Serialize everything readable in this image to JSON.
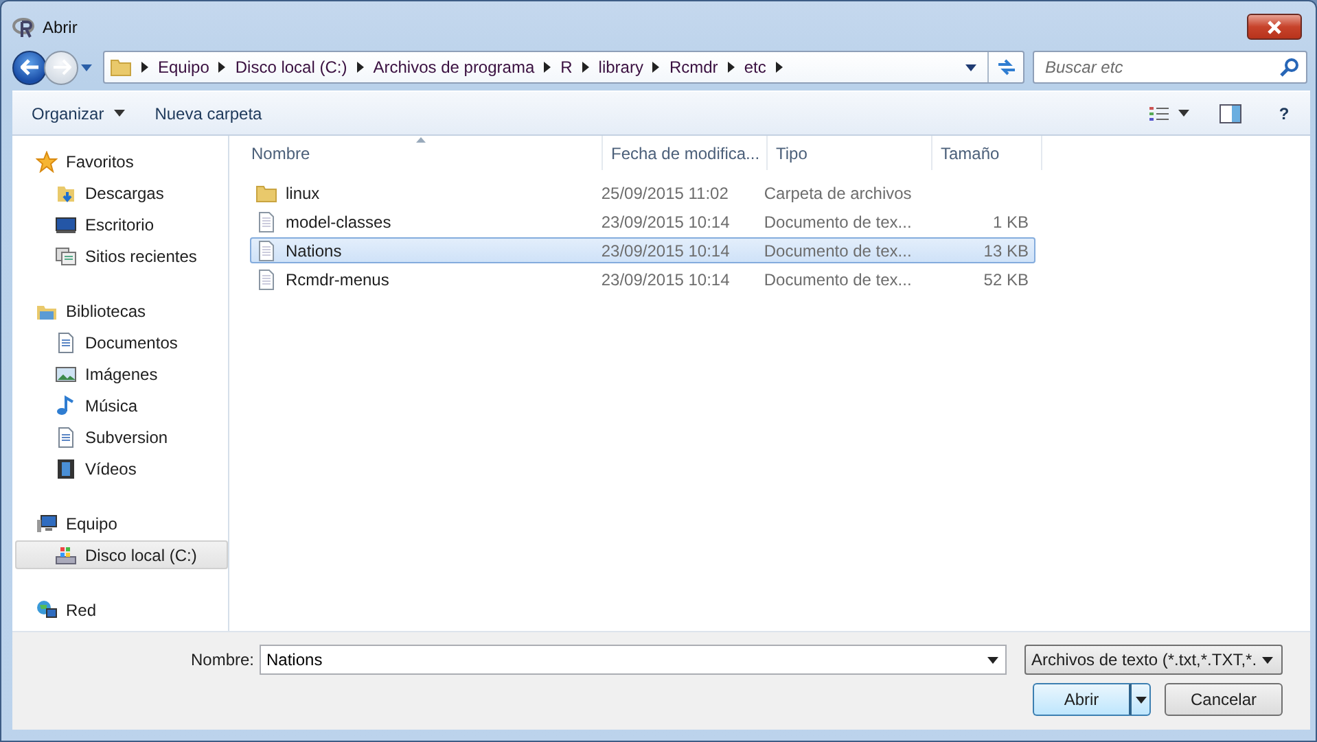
{
  "window": {
    "title": "Abrir"
  },
  "address_bar": {
    "crumbs": [
      "Equipo",
      "Disco local (C:)",
      "Archivos de programa",
      "R",
      "library",
      "Rcmdr",
      "etc"
    ]
  },
  "search": {
    "placeholder": "Buscar etc"
  },
  "toolbar": {
    "organize": "Organizar",
    "new_folder": "Nueva carpeta",
    "help": "?"
  },
  "sidebar": {
    "groups": [
      {
        "label": "Favoritos",
        "kind": "star",
        "selected": false,
        "children": [
          {
            "label": "Descargas",
            "kind": "downloads",
            "selected": false
          },
          {
            "label": "Escritorio",
            "kind": "desktop",
            "selected": false
          },
          {
            "label": "Sitios recientes",
            "kind": "recent",
            "selected": false
          }
        ]
      },
      {
        "label": "Bibliotecas",
        "kind": "library",
        "selected": false,
        "children": [
          {
            "label": "Documentos",
            "kind": "document",
            "selected": false
          },
          {
            "label": "Imágenes",
            "kind": "pictures",
            "selected": false
          },
          {
            "label": "Música",
            "kind": "music",
            "selected": false
          },
          {
            "label": "Subversion",
            "kind": "document",
            "selected": false
          },
          {
            "label": "Vídeos",
            "kind": "video",
            "selected": false
          }
        ]
      },
      {
        "label": "Equipo",
        "kind": "computer",
        "selected": false,
        "children": [
          {
            "label": "Disco local (C:)",
            "kind": "drive",
            "selected": true
          }
        ]
      },
      {
        "label": "Red",
        "kind": "network",
        "selected": false
      }
    ]
  },
  "table": {
    "columns": [
      "Nombre",
      "Fecha de modifica...",
      "Tipo",
      "Tamaño"
    ],
    "rows": [
      {
        "kind": "folder",
        "name": "linux",
        "date": "25/09/2015 11:02",
        "type": "Carpeta de archivos",
        "selected": false
      },
      {
        "kind": "text",
        "name": "model-classes",
        "date": "23/09/2015 10:14",
        "type": "Documento de tex...",
        "size": "1 KB",
        "selected": false
      },
      {
        "kind": "text",
        "name": "Nations",
        "date": "23/09/2015 10:14",
        "type": "Documento de tex...",
        "size": "13 KB",
        "selected": true
      },
      {
        "kind": "text",
        "name": "Rcmdr-menus",
        "date": "23/09/2015 10:14",
        "type": "Documento de tex...",
        "size": "52 KB",
        "selected": false
      }
    ]
  },
  "footer": {
    "filename_label": "Nombre:",
    "filename": "Nations",
    "filter": "Archivos de texto (*.txt,*.TXT,*.",
    "open": "Abrir",
    "cancel": "Cancelar"
  }
}
